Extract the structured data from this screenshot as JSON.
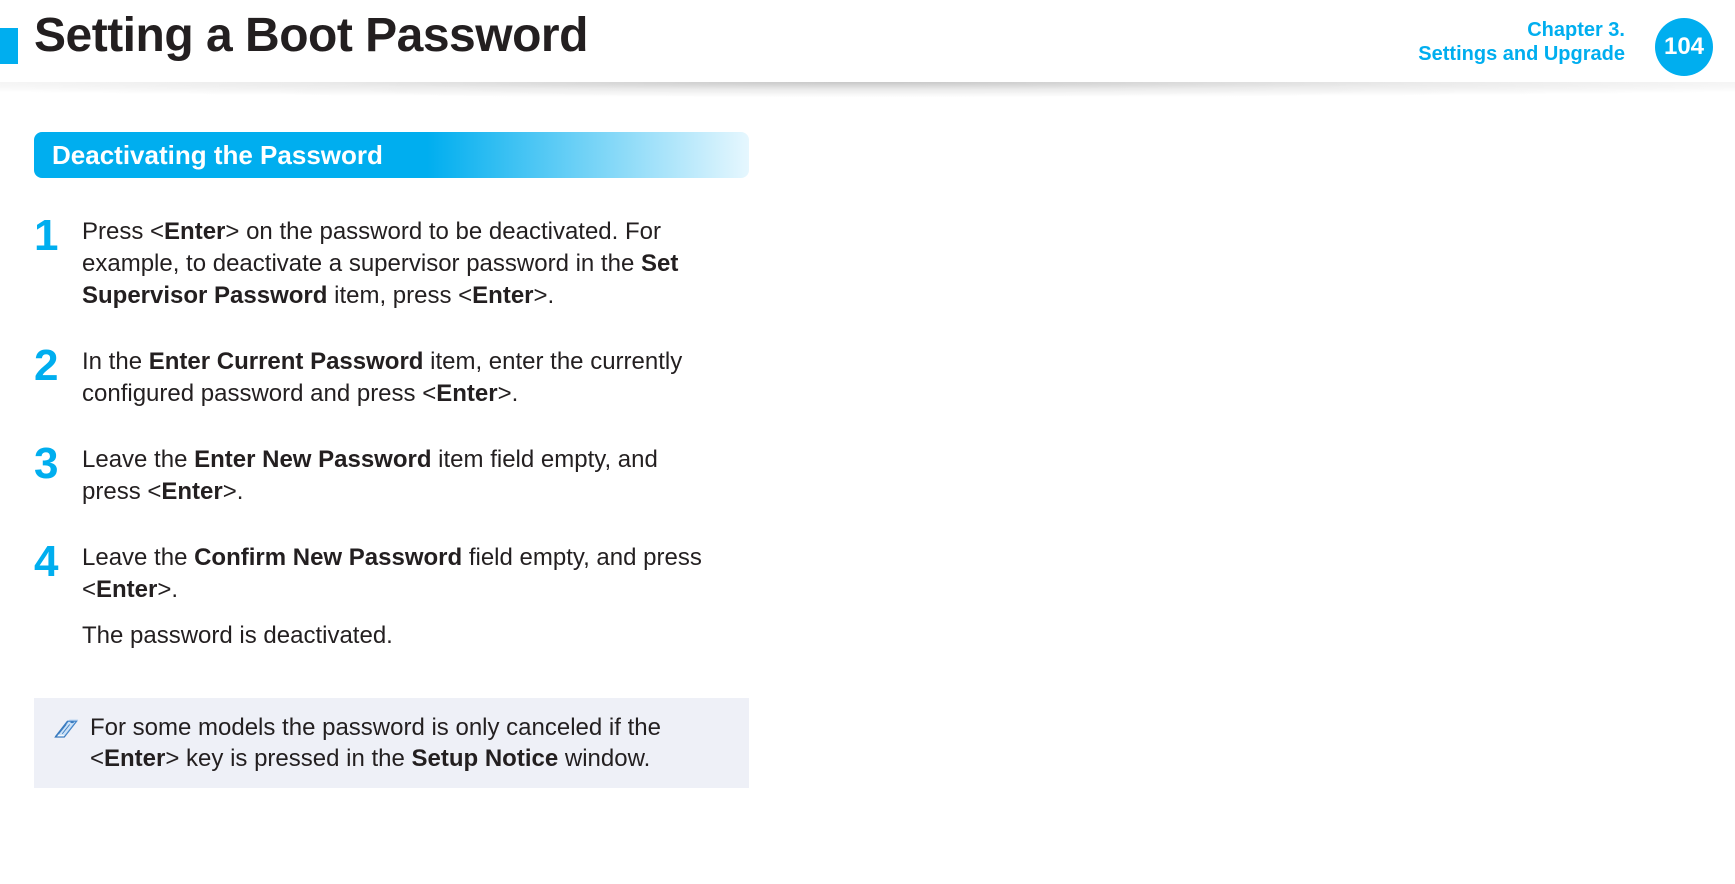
{
  "header": {
    "title": "Setting a Boot Password",
    "chapter_line1": "Chapter 3.",
    "chapter_line2": "Settings and Upgrade",
    "page_number": "104"
  },
  "section": {
    "heading": "Deactivating the Password"
  },
  "steps": [
    {
      "num": "1",
      "html": "Press <<b>Enter</b>> on the password to be deactivated. For example, to deactivate a supervisor password in the <b>Set Supervisor Password</b> item, press <<b>Enter</b>>."
    },
    {
      "num": "2",
      "html": "In the <b>Enter Current Password</b> item, enter the currently configured password and press <<b>Enter</b>>."
    },
    {
      "num": "3",
      "html": "Leave the <b>Enter New Password</b> item field empty, and press <<b>Enter</b>>."
    },
    {
      "num": "4",
      "html": "Leave the <b>Confirm New Password</b> field empty, and press <<b>Enter</b>>.",
      "result": "The password is deactivated."
    }
  ],
  "note": {
    "html": "For some models the password is only canceled if the <<b>Enter</b>> key is pressed in the <b>Setup Notice</b> window."
  }
}
